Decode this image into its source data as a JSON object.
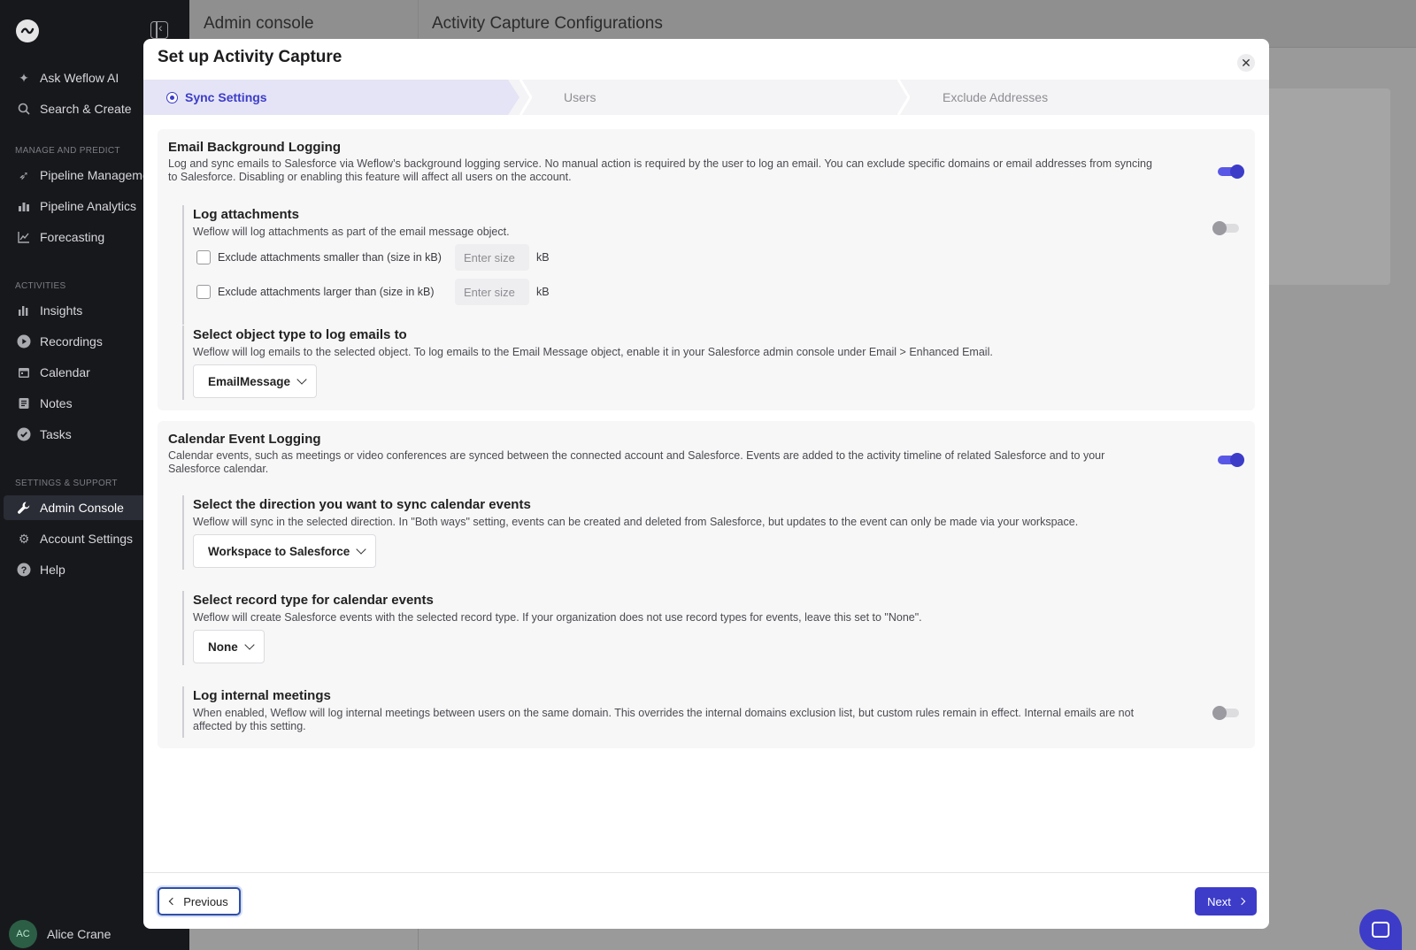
{
  "sidebar": {
    "top_items": [
      {
        "label": "Ask Weflow AI",
        "icon": "sparkle-icon"
      },
      {
        "label": "Search & Create",
        "icon": "search-icon"
      }
    ],
    "sections": [
      {
        "title": "MANAGE AND PREDICT",
        "items": [
          {
            "label": "Pipeline Management",
            "icon": "rocket-icon"
          },
          {
            "label": "Pipeline Analytics",
            "icon": "bar-chart-icon"
          },
          {
            "label": "Forecasting",
            "icon": "line-chart-icon"
          }
        ]
      },
      {
        "title": "ACTIVITIES",
        "items": [
          {
            "label": "Insights",
            "icon": "insights-icon"
          },
          {
            "label": "Recordings",
            "icon": "play-icon"
          },
          {
            "label": "Calendar",
            "icon": "calendar-icon"
          },
          {
            "label": "Notes",
            "icon": "notes-icon"
          },
          {
            "label": "Tasks",
            "icon": "check-circle-icon"
          }
        ]
      },
      {
        "title": "SETTINGS & SUPPORT",
        "items": [
          {
            "label": "Admin Console",
            "icon": "wrench-icon",
            "active": true
          },
          {
            "label": "Account Settings",
            "icon": "gear-icon"
          },
          {
            "label": "Help",
            "icon": "help-icon"
          }
        ]
      }
    ],
    "user": {
      "initials": "AC",
      "name": "Alice Crane"
    }
  },
  "background": {
    "left_title": "Admin console",
    "right_title": "Activity Capture Configurations"
  },
  "modal": {
    "title": "Set up Activity Capture",
    "steps": [
      {
        "label": "Sync Settings",
        "active": true
      },
      {
        "label": "Users",
        "active": false
      },
      {
        "label": "Exclude Addresses",
        "active": false
      }
    ],
    "email": {
      "title": "Email Background Logging",
      "desc_line1": "Log and sync emails to Salesforce via Weflow’s background logging service. No manual action is required by the user to log an email. You can exclude specific domains or email addresses from syncing",
      "desc_line2": "to Salesforce. Disabling or enabling this feature will affect all users on the account.",
      "enabled": true,
      "attachments": {
        "title": "Log attachments",
        "desc": "Weflow will log attachments as part of the email message object.",
        "enabled": false,
        "smaller_label": "Exclude attachments smaller than (size in kB)",
        "larger_label": "Exclude attachments larger than (size in kB)",
        "placeholder": "Enter size",
        "unit": "kB"
      },
      "object_type": {
        "title": "Select object type to log emails to",
        "desc": "Weflow will log emails to the selected object. To log emails to the Email Message object, enable it in your Salesforce admin console under Email > Enhanced Email.",
        "value": "EmailMessage"
      }
    },
    "calendar": {
      "title": "Calendar Event Logging",
      "desc_line1": "Calendar events, such as meetings or video conferences are synced between the connected account and Salesforce. Events are added to the activity timeline of related Salesforce and to your",
      "desc_line2": "Salesforce calendar.",
      "enabled": true,
      "direction": {
        "title": "Select the direction you want to sync calendar events",
        "desc": "Weflow will sync in the selected direction. In \"Both ways\" setting, events can be created and deleted from Salesforce, but updates to the event can only be made via your workspace.",
        "value": "Workspace to Salesforce"
      },
      "record_type": {
        "title": "Select record type for calendar events",
        "desc": "Weflow will create Salesforce events with the selected record type. If your organization does not use record types for events, leave this set to \"None\".",
        "value": "None"
      },
      "internal": {
        "title": "Log internal meetings",
        "desc_line1": "When enabled, Weflow will log internal meetings between users on the same domain. This overrides the internal domains exclusion list, but custom rules remain in effect. Internal emails are not",
        "desc_line2": "affected by this setting.",
        "enabled": false
      }
    },
    "previous_label": "Previous",
    "next_label": "Next"
  },
  "colors": {
    "accent": "#3d3cc9",
    "sidebar_bg": "#17181c",
    "overlay_bg": "#9a9a9a"
  }
}
